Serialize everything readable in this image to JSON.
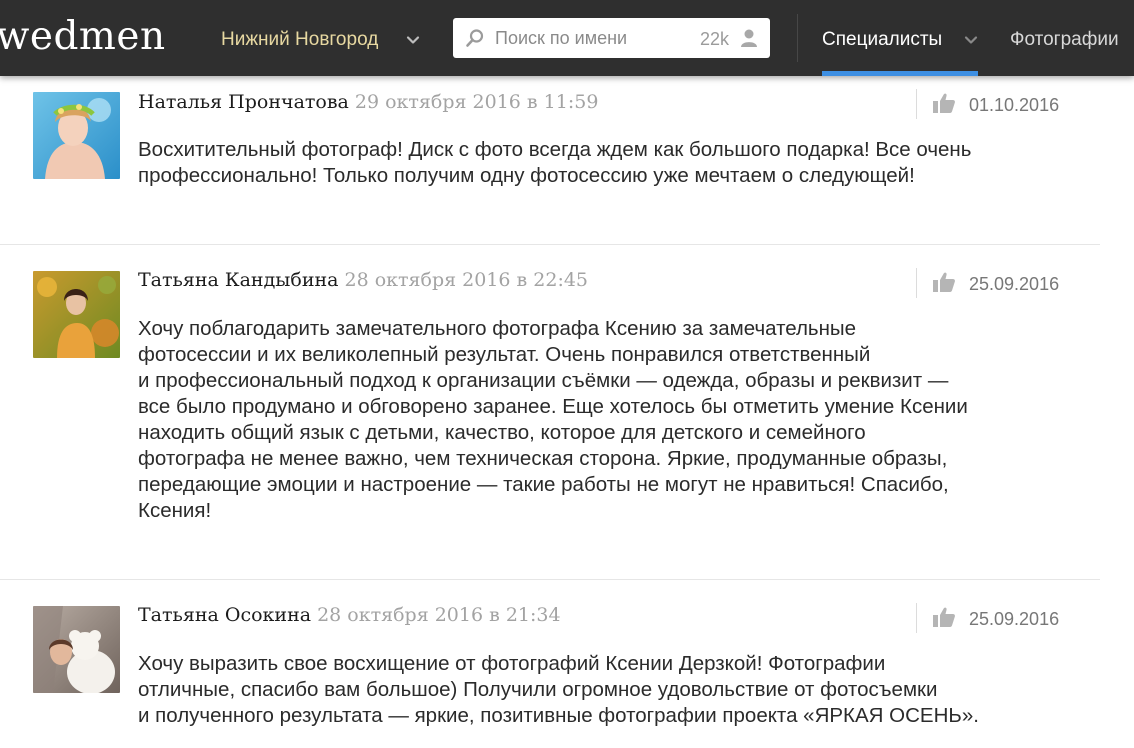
{
  "header": {
    "logo": "wedmen",
    "city": "Нижний Новгород",
    "search": {
      "placeholder": "Поиск по имени",
      "count": "22k"
    },
    "nav": [
      {
        "label": "Специалисты",
        "active": true
      },
      {
        "label": "Фотографии",
        "active": false
      }
    ]
  },
  "colors": {
    "topbar": "#2f2f2f",
    "city_text": "#e7d8a1",
    "accent": "#3d8fe3",
    "date_text": "#a3a3a3"
  },
  "reviews": [
    {
      "name": "Наталья Прончатова",
      "date": "29 октября 2016 в 11:59",
      "like_date": "01.10.2016",
      "text": "Восхитительный фотограф! Диск с фото всегда ждем как большого подарка! Все очень\nпрофессионально! Только получим одну фотосессию уже мечтаем о следующей!"
    },
    {
      "name": "Татьяна Кандыбина",
      "date": "28 октября 2016 в 22:45",
      "like_date": "25.09.2016",
      "text": "Хочу поблагодарить замечательного фотографа Ксению за замечательные\nфотосессии и их великолепный результат. Очень понравился ответственный\nи профессиональный подход к организации съёмки — одежда, образы и реквизит —\nвсе было продумано и обговорено заранее. Еще хотелось бы отметить умение Ксении\nнаходить общий язык с детьми, качество, которое для детского и семейного\nфотографа не менее важно, чем техническая сторона. Яркие, продуманные образы,\nпередающие эмоции и настроение — такие работы не могут не нравиться! Спасибо,\nКсения!"
    },
    {
      "name": "Татьяна Осокина",
      "date": "28 октября 2016 в 21:34",
      "like_date": "25.09.2016",
      "text": "Хочу выразить свое восхищение от фотографий Ксении Дерзкой! Фотографии\nотличные, спасибо вам большое) Получили огромное удовольствие от фотосъемки\nи полученного результата — яркие, позитивные фотографии проекта «ЯРКАЯ ОСЕНЬ»."
    }
  ]
}
